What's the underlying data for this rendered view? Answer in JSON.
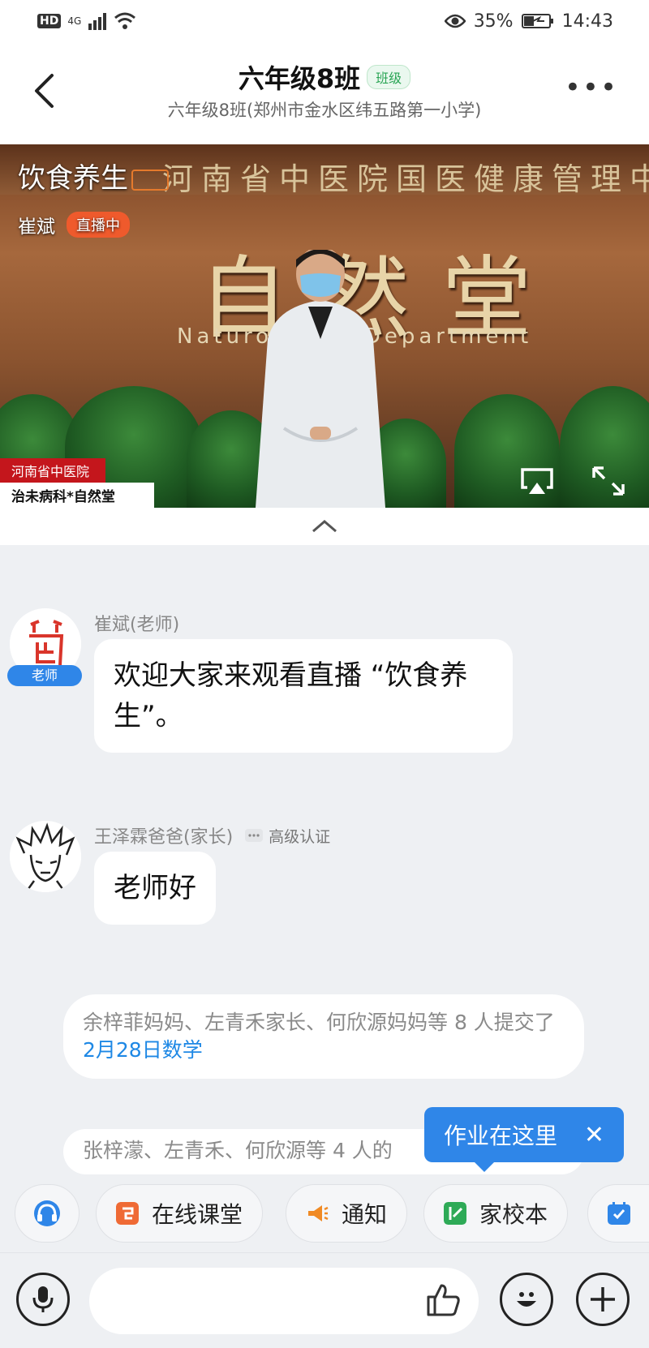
{
  "status_bar": {
    "hd": "HD",
    "network": "4G",
    "battery": "35%",
    "time": "14:43"
  },
  "header": {
    "title": "六年级8班",
    "badge": "班级",
    "subtitle": "六年级8班(郑州市金水区纬五路第一小学)",
    "more_label": "•••"
  },
  "video": {
    "title": "饮食养生",
    "streamer": "崔斌",
    "live_badge": "直播中",
    "background_wall_text": "河南省中医院国医健康管理中心",
    "background_sign": "自然堂",
    "background_sign_en": "Naturopathy Department",
    "corner_tag_line1": "河南省中医院",
    "corner_tag_line2": "治未病科*自然堂"
  },
  "messages": [
    {
      "sender": "崔斌(老师)",
      "role_tag": "老师",
      "text": "欢迎大家来观看直播 “饮食养生”。"
    },
    {
      "sender": "王泽霖爸爸(家长)",
      "verify": "高级认证",
      "text": "老师好"
    }
  ],
  "notices": [
    {
      "text_prefix": "余梓菲妈妈、左青禾家长、何欣源妈妈等 8 人提交了",
      "link": "2月28日数学"
    },
    {
      "text_prefix": "张梓濛、左青禾、何欣源等 4 人的"
    }
  ],
  "tooltip": {
    "text": "作业在这里",
    "close": "✕"
  },
  "toolbar": {
    "items": [
      {
        "label": "在线课堂"
      },
      {
        "label": "通知"
      },
      {
        "label": "家校本"
      }
    ]
  },
  "input": {
    "placeholder": ""
  },
  "colors": {
    "accent": "#2f86e8",
    "live": "#ef5a2c",
    "link": "#1e88e5",
    "badge_green": "#2aa555"
  },
  "icons": [
    "signal-icon",
    "wifi-icon",
    "eye-icon",
    "battery-icon",
    "back-icon",
    "more-icon",
    "cast-icon",
    "fullscreen-icon",
    "chevron-up-icon",
    "headset-icon",
    "online-class-icon",
    "notice-icon",
    "home-school-icon",
    "task-icon",
    "mic-icon",
    "thumbs-up-icon",
    "emoji-icon",
    "plus-icon"
  ]
}
